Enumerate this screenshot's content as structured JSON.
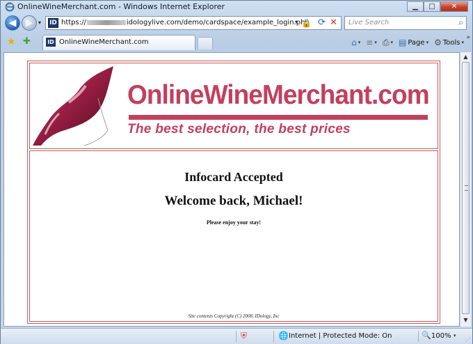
{
  "window": {
    "title": "OnlineWineMerchant.com - Windows Internet Explorer",
    "minimize": "▁",
    "maximize": "□",
    "close": "✕"
  },
  "nav": {
    "back_glyph": "◀",
    "forward_glyph": "▶",
    "history_glyph": "▾",
    "favicon_text": "ID",
    "url_prefix": "https://",
    "url_suffix": "idologylive.com/demo/cardspace/example_login.php",
    "dropdown_glyph": "▾",
    "lock_icon": "🔒",
    "refresh_icon": "⟳",
    "stop_icon": "✕",
    "search_placeholder": "Live Search",
    "search_icon": "⌕"
  },
  "tabs": {
    "favorites_icon": "★",
    "add_favorites_icon": "✚",
    "active_tab": {
      "favicon_text": "ID",
      "label": "OnlineWineMerchant.com"
    }
  },
  "commands": {
    "home_icon": "⌂",
    "feeds_icon": "≡",
    "print_icon": "⎙",
    "page_label": "Page",
    "tools_label": "Tools",
    "page_icon": "▤",
    "tools_icon": "⚙",
    "dd_glyph": "▾",
    "more_glyph": "»"
  },
  "page": {
    "brand": "OnlineWineMerchant.com",
    "tagline": "The best selection, the best prices",
    "heading_accepted": "Infocard Accepted",
    "heading_welcome": "Welcome back, Michael!",
    "enjoy": "Please enjoy your stay!",
    "copyright": "Site contents Copyright (C) 2008, IDology, Inc"
  },
  "status": {
    "shield_icon": "⛨",
    "globe_icon": "🌐",
    "zone": "Internet | Protected Mode: On",
    "zoom_icon": "🔍",
    "zoom": "100%",
    "zoom_dd": "▾"
  },
  "colors": {
    "brand": "#c2405f",
    "frame_border": "#c85a5a"
  }
}
